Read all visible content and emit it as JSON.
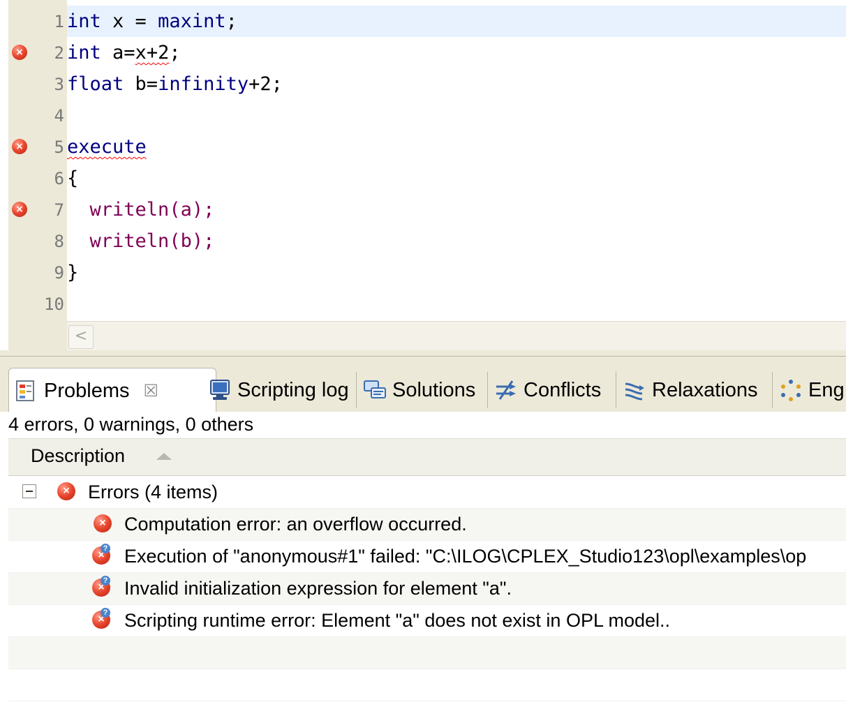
{
  "editor": {
    "lines": [
      {
        "num": "1",
        "error": false,
        "current": true
      },
      {
        "num": "2",
        "error": true,
        "current": false
      },
      {
        "num": "3",
        "error": false,
        "current": false
      },
      {
        "num": "4",
        "error": false,
        "current": false
      },
      {
        "num": "5",
        "error": true,
        "current": false
      },
      {
        "num": "6",
        "error": false,
        "current": false
      },
      {
        "num": "7",
        "error": true,
        "current": false
      },
      {
        "num": "8",
        "error": false,
        "current": false
      },
      {
        "num": "9",
        "error": false,
        "current": false
      },
      {
        "num": "10",
        "error": false,
        "current": false
      }
    ],
    "code": {
      "l1": {
        "t1": "int",
        "t2": " x = ",
        "t3": "maxint",
        "t4": ";"
      },
      "l2": {
        "t1": "int",
        "t2": " a=",
        "t3": "x+2",
        "t4": ";"
      },
      "l3": {
        "t1": "float",
        "t2": " b=",
        "t3": "infinity",
        "t4": "+2;"
      },
      "l5": {
        "t1": "execute"
      },
      "l6": {
        "t1": "{"
      },
      "l7": {
        "t1": "  ",
        "t2": "writeln",
        "t3": "(a);"
      },
      "l8": {
        "t1": "  ",
        "t2": "writeln",
        "t3": "(b);"
      },
      "l9": {
        "t1": "}"
      }
    },
    "error_marker_glyph": "×",
    "scroll_left_glyph": "<",
    "keyword_color": "#000080",
    "function_color": "#7f0055",
    "current_line_color": "#e8f2fe"
  },
  "views": {
    "tabs": [
      {
        "label": "Problems",
        "icon": "problems-icon",
        "active": true,
        "close": "☒"
      },
      {
        "label": "Scripting log",
        "icon": "monitor-icon",
        "active": false
      },
      {
        "label": "Solutions",
        "icon": "solutions-icon",
        "active": false
      },
      {
        "label": "Conflicts",
        "icon": "conflicts-icon",
        "active": false
      },
      {
        "label": "Relaxations",
        "icon": "relaxations-icon",
        "active": false
      },
      {
        "label": "Eng",
        "icon": "engine-icon",
        "active": false
      }
    ]
  },
  "problems": {
    "summary": "4 errors, 0 warnings, 0 others",
    "column_header": "Description",
    "group": {
      "label": "Errors (4 items)",
      "expanded": true
    },
    "items": [
      {
        "text": "Computation error: an overflow occurred.",
        "icon": "error-icon"
      },
      {
        "text": "Execution of \"anonymous#1\" failed: \"C:\\ILOG\\CPLEX_Studio123\\opl\\examples\\op",
        "icon": "error-question-icon"
      },
      {
        "text": "Invalid initialization expression for element \"a\".",
        "icon": "error-question-icon"
      },
      {
        "text": "Scripting runtime error: Element \"a\" does not exist in OPL model..",
        "icon": "error-question-icon"
      }
    ],
    "question_glyph": "?"
  }
}
